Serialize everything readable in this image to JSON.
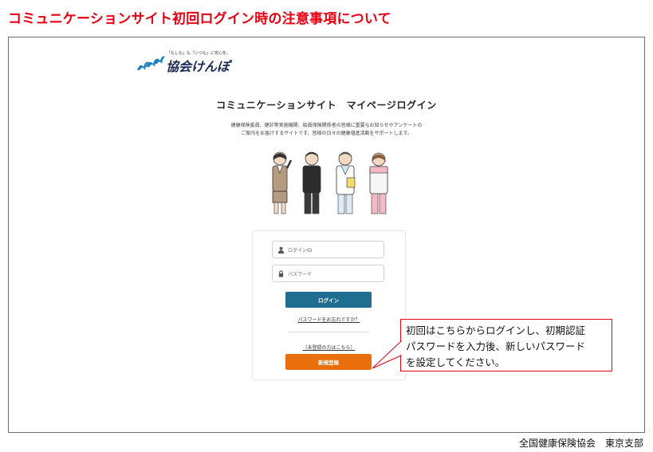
{
  "slide": {
    "title": "コミュニケーションサイト初回ログイン時の注意事項について",
    "footer_org": "全国健康保険協会　東京支部",
    "title_color": "#e60012"
  },
  "site": {
    "logo_tagline": "「もしも」も「いつも」に安心を。",
    "logo_text": "協会けんぽ",
    "logo_icon": "bird-logo-icon",
    "heading": "コミュニケーションサイト　マイページログイン",
    "description_lines": [
      "健康保険委員、健診等実施機関、船員保険関係者の皆様に重要なお知らせやアンケートの",
      "ご案内をお届けするサイトです。皆様の日々の健康増進活動をサポートします。"
    ],
    "illustration_icon": "people-illustration-icon"
  },
  "login_form": {
    "login_id_placeholder": "ログインID",
    "login_id_icon": "user-icon",
    "password_placeholder": "パスワード",
    "password_icon": "lock-icon",
    "login_button": "ログイン",
    "login_button_color": "#1f6d8f",
    "forgot_password": "パスワードをお忘れですか？",
    "unregistered_text": "（未登録の方はこちら）",
    "register_button": "新規登録",
    "register_button_color": "#ea6f0c"
  },
  "callout": {
    "lines": [
      "初回はこちらからログインし、初期認証",
      "パスワードを入力後、新しいパスワード",
      "を設定してください。"
    ],
    "border_color": "#e60012"
  }
}
